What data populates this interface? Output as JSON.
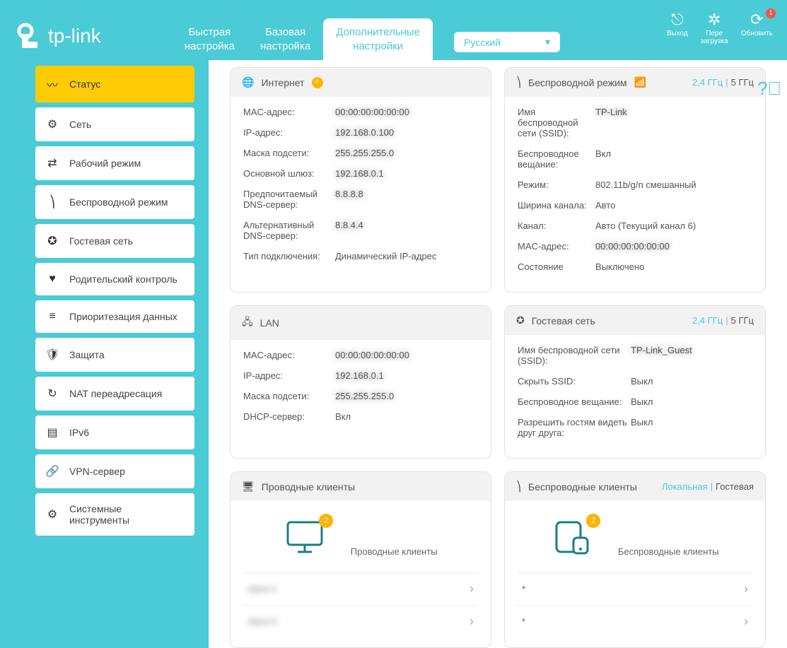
{
  "brand": "tp-link",
  "top_actions": {
    "logout": "Выход",
    "reboot": "Пере\nзагрузка",
    "update": "Обновить",
    "update_badge": "1"
  },
  "tabs": {
    "quick": "Быстрая\nнастройка",
    "basic": "Базовая\nнастройка",
    "advanced": "Дополнительные\nнастройки"
  },
  "language": "Русский",
  "sidebar": {
    "items": [
      {
        "label": "Статус"
      },
      {
        "label": "Сеть"
      },
      {
        "label": "Рабочий режим"
      },
      {
        "label": "Беспроводной режим"
      },
      {
        "label": "Гостевая сеть"
      },
      {
        "label": "Родительский контроль"
      },
      {
        "label": "Приоритезация данных"
      },
      {
        "label": "Защита"
      },
      {
        "label": "NAT переадресация"
      },
      {
        "label": "IPv6"
      },
      {
        "label": "VPN-сервер"
      },
      {
        "label": "Системные инструменты"
      }
    ]
  },
  "freq": {
    "g24": "2,4 ГГц",
    "g5": "5 ГГц",
    "sep": "|"
  },
  "internet": {
    "title": "Интернет",
    "mac_l": "MAC-адрес:",
    "mac_v": "00:00:00:00:00:00",
    "ip_l": "IP-адрес:",
    "ip_v": "192.168.0.100",
    "mask_l": "Маска подсети:",
    "mask_v": "255.255.255.0",
    "gw_l": "Основной шлюз:",
    "gw_v": "192.168.0.1",
    "dns1_l": "Предпочитаемый DNS-сервер:",
    "dns1_v": "8.8.8.8",
    "dns2_l": "Альтернативный DNS-сервер:",
    "dns2_v": "8.8.4.4",
    "type_l": "Тип подключения:",
    "type_v": "Динамический IP-адрес"
  },
  "wireless": {
    "title": "Беспроводной режим",
    "ssid_l": "Имя беспроводной сети (SSID):",
    "ssid_v": "TP-Link",
    "radio_l": "Беспроводное вещание:",
    "radio_v": "Вкл",
    "mode_l": "Режим:",
    "mode_v": "802.11b/g/n смешанный",
    "width_l": "Ширина канала:",
    "width_v": "Авто",
    "chan_l": "Канал:",
    "chan_v": "Авто (Текущий канал 6)",
    "mac_l": "MAC-адрес:",
    "mac_v": "00:00:00:00:00:00",
    "state_l": "Состояние",
    "state_v": "Выключено"
  },
  "lan": {
    "title": "LAN",
    "mac_l": "MAC-адрес:",
    "mac_v": "00:00:00:00:00:00",
    "ip_l": "IP-адрес:",
    "ip_v": "192.168.0.1",
    "mask_l": "Маска подсети:",
    "mask_v": "255.255.255.0",
    "dhcp_l": "DHCP-сервер:",
    "dhcp_v": "Вкл"
  },
  "guest": {
    "title": "Гостевая сеть",
    "ssid_l": "Имя беспроводной сети (SSID):",
    "ssid_v": "TP-Link_Guest",
    "hide_l": "Скрыть SSID:",
    "hide_v": "Выкл",
    "radio_l": "Беспроводное вещание:",
    "radio_v": "Выкл",
    "see_l": "Разрешить гостям видеть друг друга:",
    "see_v": "Выкл"
  },
  "wired_clients": {
    "title": "Проводные клиенты",
    "count": "2",
    "label": "Проводные клиенты",
    "rows": [
      "client-1",
      "client-2"
    ]
  },
  "wireless_clients": {
    "title": "Беспроводные клиенты",
    "tab_local": "Локальная",
    "tab_guest": "Гостевая",
    "count": "2",
    "label": "Беспроводные клиенты",
    "rows": [
      "*",
      "*"
    ]
  }
}
